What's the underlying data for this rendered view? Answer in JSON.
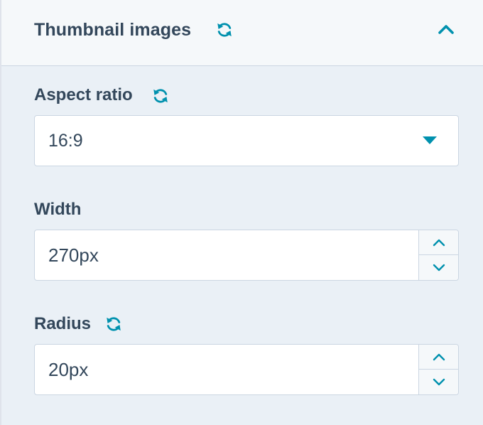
{
  "section": {
    "title": "Thumbnail images",
    "icons": {
      "sync": "refresh-icon",
      "collapse": "chevron-up-icon"
    }
  },
  "fields": {
    "aspect_ratio": {
      "label": "Aspect ratio",
      "value": "16:9"
    },
    "width": {
      "label": "Width",
      "value": "270px"
    },
    "radius": {
      "label": "Radius",
      "value": "20px"
    }
  },
  "colors": {
    "accent": "#0091ae",
    "text": "#33475b",
    "panel_bg": "#eaf0f6",
    "header_bg": "#f5f8fa",
    "border": "#cbd6e2"
  }
}
